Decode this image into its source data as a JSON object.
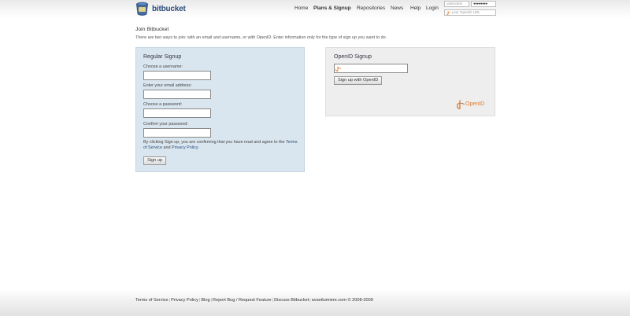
{
  "header": {
    "brand": "bitbucket",
    "nav": [
      {
        "label": "Home",
        "active": false
      },
      {
        "label": "Plans & Signup",
        "active": true
      },
      {
        "label": "Repositories",
        "active": false
      },
      {
        "label": "News",
        "active": false
      },
      {
        "label": "Help",
        "active": false
      },
      {
        "label": "Login",
        "active": false
      }
    ],
    "login": {
      "username_placeholder": "username",
      "password_value": "●●●●●●●●",
      "openid_placeholder": "your OpenID URL"
    }
  },
  "page": {
    "title": "Join Bitbucket",
    "intro": "There are two ways to join: with an email and username, or with OpenID. Enter information only for the type of sign up you want to do."
  },
  "regular": {
    "heading": "Regular Signup",
    "username_label": "Choose a username:",
    "email_label": "Enter your email address:",
    "password_label": "Choose a password:",
    "confirm_label": "Confirm your password:",
    "terms_prefix": "By clicking Sign up, you are confirming that you have read and agree to the",
    "terms_link": "Terms of Service",
    "terms_and": "and",
    "privacy_link": "Privacy Policy",
    "terms_end": ".",
    "submit": "Sign up"
  },
  "openid": {
    "heading": "OpenID Signup",
    "submit": "Sign up with OpenID",
    "logo_text": "OpenID"
  },
  "footer": {
    "links": [
      "Terms of Service",
      "Privacy Policy",
      "Blog",
      "Report Bug / Request Feature",
      "Discuss Bitbucket"
    ],
    "copyright": "avantlumiere.com © 2008-2009"
  },
  "colors": {
    "brand": "#2b4d7a",
    "regular_panel": "#dae6ef",
    "openid_panel": "#eeeeee",
    "openid_orange": "#e07a2c"
  }
}
